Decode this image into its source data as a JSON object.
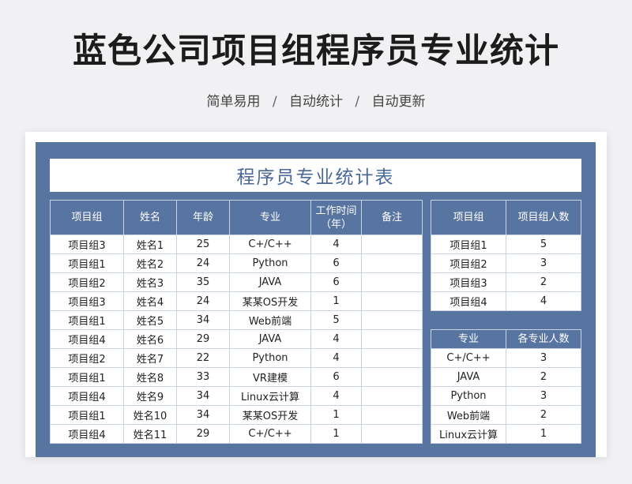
{
  "page": {
    "title": "蓝色公司项目组程序员专业统计",
    "tags": [
      "简单易用",
      "自动统计",
      "自动更新"
    ],
    "separator": "/"
  },
  "sheet": {
    "title": "程序员专业统计表",
    "main_table": {
      "headers": [
        "项目组",
        "姓名",
        "年龄",
        "专业",
        "工作时间\n（年）",
        "备注"
      ],
      "rows": [
        [
          "项目组3",
          "姓名1",
          "25",
          "C+/C++",
          "4",
          ""
        ],
        [
          "项目组1",
          "姓名2",
          "24",
          "Python",
          "6",
          ""
        ],
        [
          "项目组2",
          "姓名3",
          "35",
          "JAVA",
          "6",
          ""
        ],
        [
          "项目组3",
          "姓名4",
          "24",
          "某某OS开发",
          "1",
          ""
        ],
        [
          "项目组1",
          "姓名5",
          "34",
          "Web前端",
          "5",
          ""
        ],
        [
          "项目组4",
          "姓名6",
          "29",
          "JAVA",
          "4",
          ""
        ],
        [
          "项目组2",
          "姓名7",
          "22",
          "Python",
          "4",
          ""
        ],
        [
          "项目组1",
          "姓名8",
          "33",
          "VR建模",
          "6",
          ""
        ],
        [
          "项目组4",
          "姓名9",
          "34",
          "Linux云计算",
          "4",
          ""
        ],
        [
          "项目组1",
          "姓名10",
          "34",
          "某某OS开发",
          "1",
          ""
        ],
        [
          "项目组4",
          "姓名11",
          "29",
          "C+/C++",
          "1",
          ""
        ]
      ]
    },
    "group_table": {
      "headers": [
        "项目组",
        "项目组人数"
      ],
      "rows": [
        [
          "项目组1",
          "5"
        ],
        [
          "项目组2",
          "3"
        ],
        [
          "项目组3",
          "2"
        ],
        [
          "项目组4",
          "4"
        ]
      ]
    },
    "major_table": {
      "headers": [
        "专业",
        "各专业人数"
      ],
      "rows": [
        [
          "C+/C++",
          "3"
        ],
        [
          "JAVA",
          "2"
        ],
        [
          "Python",
          "3"
        ],
        [
          "Web前端",
          "2"
        ],
        [
          "Linux云计算",
          "1"
        ]
      ]
    }
  },
  "colors": {
    "header_bg": "#5874a0",
    "title_text": "#4a6896"
  }
}
